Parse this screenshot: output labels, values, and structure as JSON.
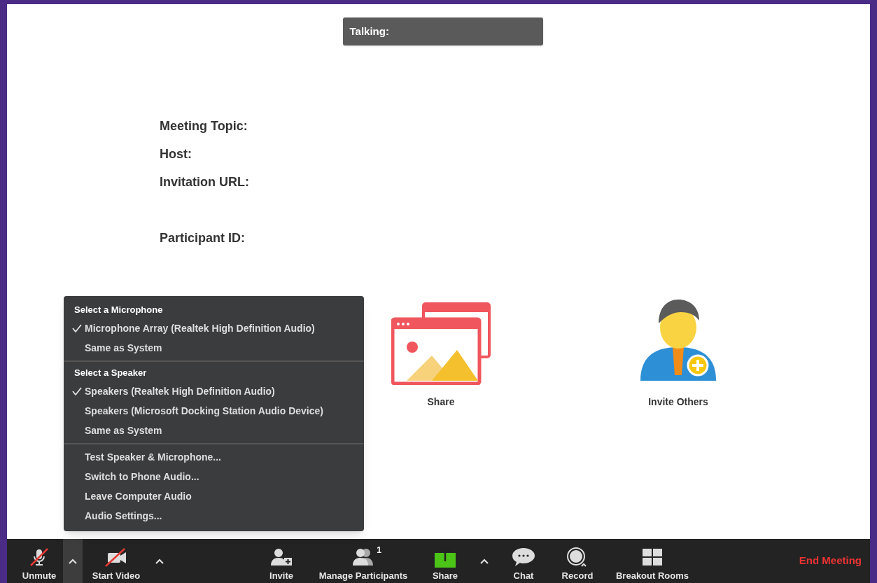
{
  "talking_bar": {
    "label": "Talking:"
  },
  "meeting_info": {
    "details": [
      "Meeting Topic:",
      "Host:",
      "Invitation URL:"
    ],
    "participant": "Participant ID:"
  },
  "tiles": [
    {
      "kind": "share",
      "label": "Share"
    },
    {
      "kind": "invite",
      "label": "Invite Others"
    }
  ],
  "audio_menu": {
    "sections": [
      {
        "heading": "Select a Microphone",
        "items": [
          {
            "label": "Microphone Array (Realtek High Definition Audio)",
            "checked": true
          },
          {
            "label": "Same as System",
            "checked": false
          }
        ]
      },
      {
        "heading": "Select a Speaker",
        "items": [
          {
            "label": "Speakers (Realtek High Definition Audio)",
            "checked": true
          },
          {
            "label": "Speakers (Microsoft Docking Station Audio Device)",
            "checked": false
          },
          {
            "label": "Same as System",
            "checked": false
          }
        ]
      },
      {
        "items": [
          {
            "label": "Test Speaker & Microphone...",
            "checked": false
          },
          {
            "label": "Switch to Phone Audio...",
            "checked": false
          },
          {
            "label": "Leave Computer Audio",
            "checked": false
          },
          {
            "label": "Audio Settings...",
            "checked": false
          }
        ]
      }
    ]
  },
  "toolbar": {
    "left": [
      {
        "kind": "mic",
        "label": "Unmute"
      },
      {
        "kind": "caret",
        "selected": true
      },
      {
        "kind": "video",
        "label": "Start Video"
      },
      {
        "kind": "caret",
        "selected": false
      }
    ],
    "center": [
      {
        "kind": "invite",
        "label": "Invite"
      },
      {
        "kind": "participants",
        "label": "Manage Participants",
        "badge": "1"
      },
      {
        "kind": "share",
        "label": "Share"
      },
      {
        "kind": "caret",
        "selected": false
      },
      {
        "kind": "chat",
        "label": "Chat"
      },
      {
        "kind": "record",
        "label": "Record"
      },
      {
        "kind": "breakout",
        "label": "Breakout Rooms"
      }
    ],
    "end": {
      "label": "End Meeting"
    }
  }
}
